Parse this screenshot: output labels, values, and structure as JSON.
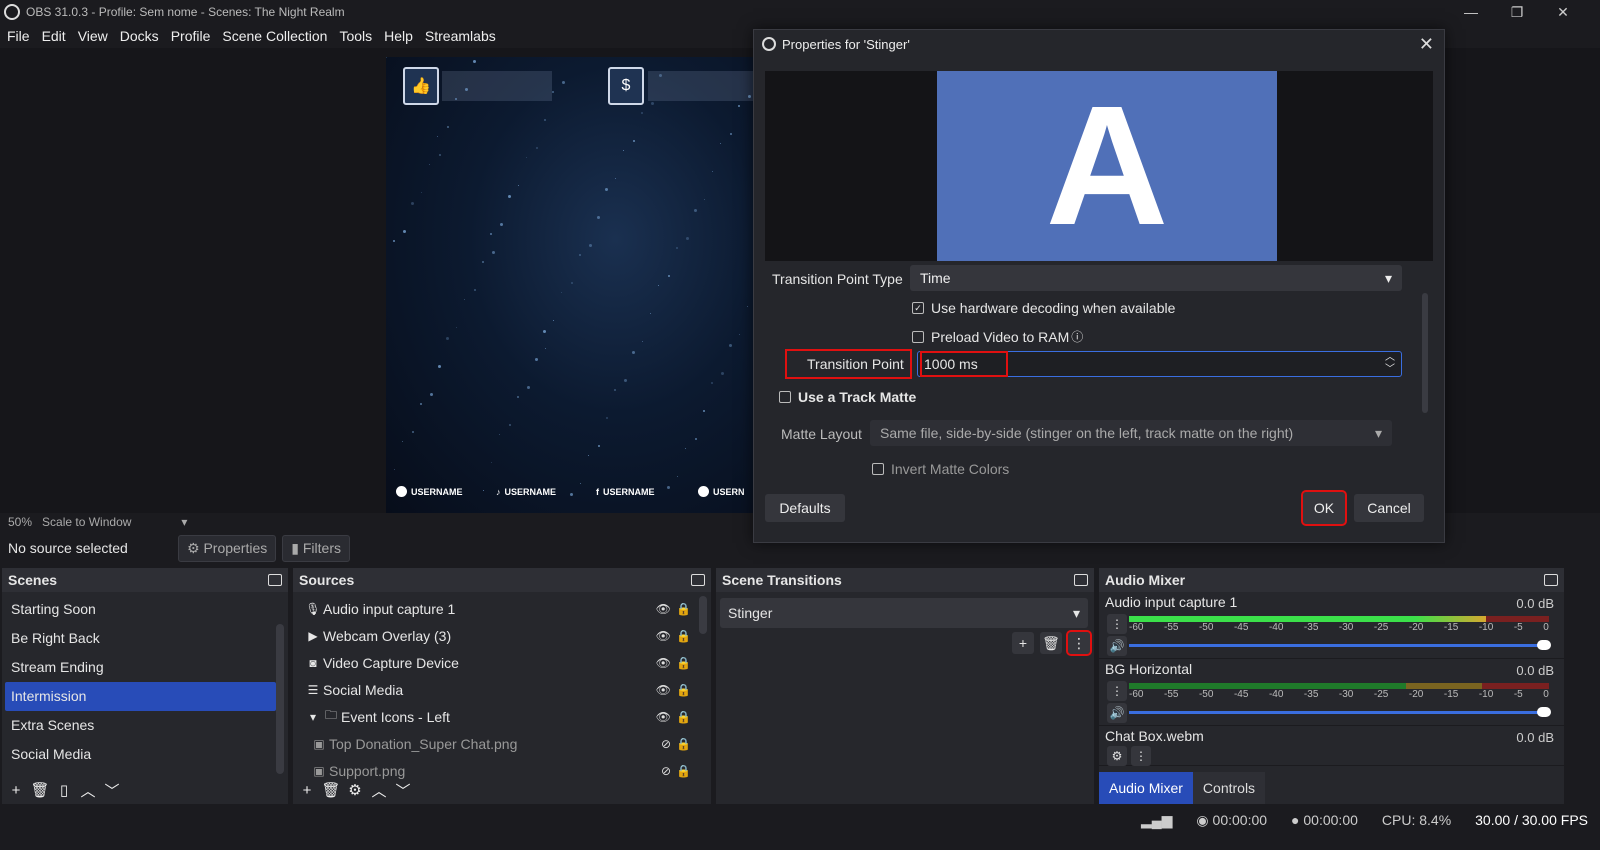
{
  "window": {
    "title": "OBS 31.0.3 - Profile: Sem nome - Scenes: The Night Realm"
  },
  "menu": [
    "File",
    "Edit",
    "View",
    "Docks",
    "Profile",
    "Scene Collection",
    "Tools",
    "Help",
    "Streamlabs"
  ],
  "canvas": {
    "socials": [
      "USERNAME",
      "USERNAME",
      "USERNAME",
      "USERN"
    ]
  },
  "scale": {
    "zoom": "50%",
    "mode": "Scale to Window"
  },
  "source_bar": {
    "status": "No source selected",
    "properties": "Properties",
    "filters": "Filters"
  },
  "scenes": {
    "title": "Scenes",
    "items": [
      "Starting Soon",
      "Be Right Back",
      "Stream Ending",
      "Intermission",
      "Extra Scenes",
      "Social Media"
    ],
    "selected": "Intermission"
  },
  "sources": {
    "title": "Sources",
    "items": [
      {
        "label": "Audio input capture 1",
        "icon": "mic-icon"
      },
      {
        "label": "Webcam Overlay (3)",
        "icon": "play-icon"
      },
      {
        "label": "Video Capture Device",
        "icon": "camera-icon"
      },
      {
        "label": "Social Media",
        "icon": "list-icon"
      },
      {
        "label": "Event Icons - Left",
        "icon": "folder-icon"
      },
      {
        "label": "Top Donation_Super Chat.png",
        "icon": "image-icon"
      },
      {
        "label": "Support.png",
        "icon": "image-icon"
      }
    ]
  },
  "transitions": {
    "title": "Scene Transitions",
    "selected": "Stinger"
  },
  "mixer": {
    "title": "Audio Mixer",
    "channels": [
      {
        "name": "Audio input capture 1",
        "db": "0.0 dB",
        "level": 0.85
      },
      {
        "name": "BG Horizontal",
        "db": "0.0 dB",
        "level": 0.0
      },
      {
        "name": "Chat Box.webm",
        "db": "0.0 dB",
        "level": 0.0
      }
    ],
    "ticks": [
      "-60",
      "-55",
      "-50",
      "-45",
      "-40",
      "-35",
      "-30",
      "-25",
      "-20",
      "-15",
      "-10",
      "-5",
      "0"
    ],
    "tabs": [
      "Audio Mixer",
      "Controls"
    ]
  },
  "status": {
    "rec_time": "00:00:00",
    "stream_time": "00:00:00",
    "cpu": "CPU: 8.4%",
    "fps": "30.00 / 30.00 FPS"
  },
  "dialog": {
    "title": "Properties for 'Stinger'",
    "preview_letter": "A",
    "transition_point_type_label": "Transition Point Type",
    "transition_point_type_value": "Time",
    "hw_decoding": "Use hardware decoding when available",
    "preload": "Preload Video to RAM",
    "transition_point_label": "Transition Point",
    "transition_point_value": "1000 ms",
    "track_matte": "Use a Track Matte",
    "matte_layout_label": "Matte Layout",
    "matte_layout_value": "Same file, side-by-side (stinger on the left, track matte on the right)",
    "invert_matte": "Invert Matte Colors",
    "defaults": "Defaults",
    "ok": "OK",
    "cancel": "Cancel"
  }
}
